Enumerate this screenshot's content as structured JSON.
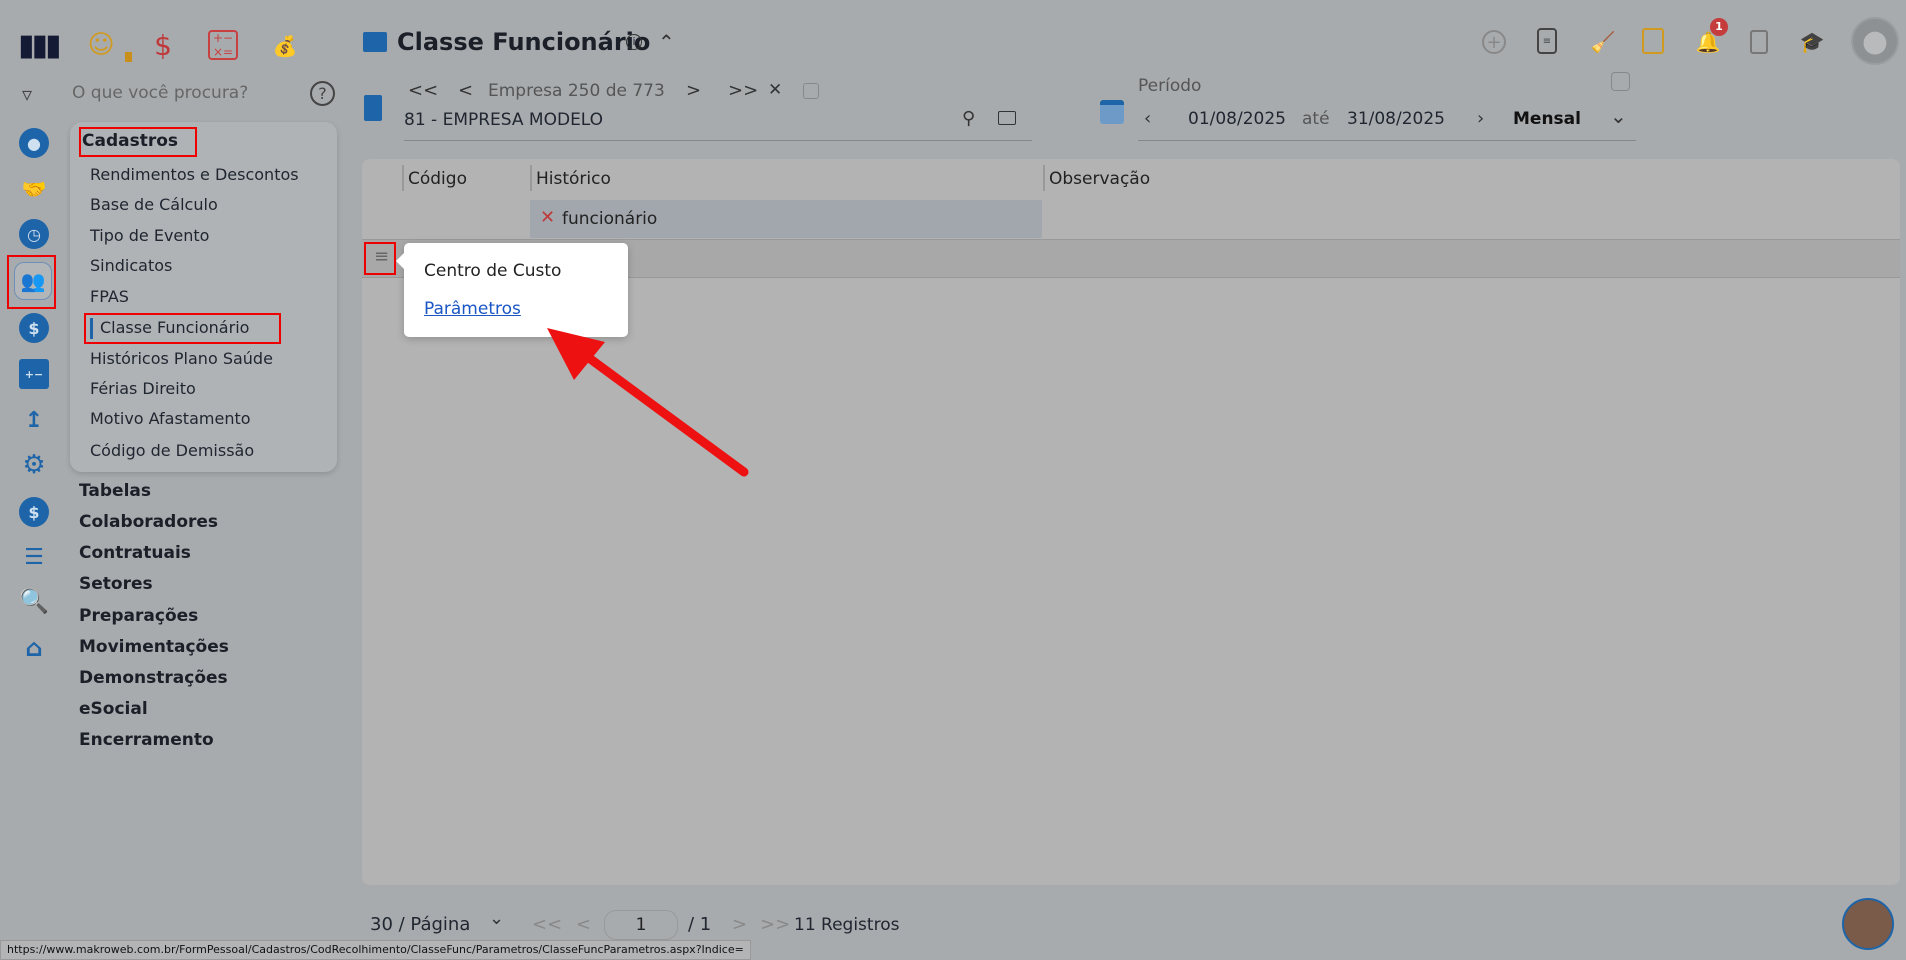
{
  "header": {
    "title": "Classe Funcionário",
    "info_icon": "info-icon",
    "collapse_icon": "chevron-up-icon"
  },
  "module_icons": [
    "people-icon",
    "dollar-icon",
    "calculator-icon",
    "money-bag-icon"
  ],
  "toolbar_icons": [
    "add-icon",
    "document-icon",
    "broom-icon",
    "note-icon",
    "bell-icon",
    "report-search-icon",
    "graduation-cap-icon",
    "user-avatar-icon"
  ],
  "notification_count": "1",
  "search": {
    "placeholder": "O que você procura?",
    "help": "?"
  },
  "empresa": {
    "nav_text": "Empresa 250 de 773",
    "first": "<<",
    "prev": "<",
    "next": ">",
    "last": ">>",
    "clear": "✕",
    "selected": "81 - EMPRESA MODELO"
  },
  "periodo": {
    "label": "Período",
    "start": "01/08/2025",
    "sep": "até",
    "end": "31/08/2025",
    "type": "Mensal"
  },
  "menu": {
    "title": "Cadastros",
    "items": [
      "Rendimentos e Descontos",
      "Base de Cálculo",
      "Tipo de Evento",
      "Sindicatos",
      "FPAS",
      "Classe Funcionário",
      "Históricos Plano Saúde",
      "Férias Direito",
      "Motivo Afastamento",
      "Código de Demissão"
    ],
    "active": "Classe Funcionário"
  },
  "sections": [
    "Tabelas",
    "Colaboradores",
    "Contratuais",
    "Setores",
    "Preparações",
    "Movimentações",
    "Demonstrações",
    "eSocial",
    "Encerramento"
  ],
  "table": {
    "columns": [
      "Código",
      "Histórico",
      "Observação"
    ],
    "filter_value": "funcionário",
    "row_partial": "o"
  },
  "context_menu": {
    "items": [
      "Centro de Custo",
      "Parâmetros"
    ]
  },
  "pagination": {
    "page_size": "30 / Página",
    "page": "1",
    "total_pages": "/ 1",
    "records": "11 Registros",
    "first": "<<",
    "prev": "<",
    "next": ">",
    "last": ">>"
  },
  "status_url": "https://www.makroweb.com.br/FormPessoal/Cadastros/CodRecolhimento/ClasseFunc/Parametros/ClasseFuncParametros.aspx?Indice=",
  "colors": {
    "accent": "#1d64a8",
    "highlight": "#e00000",
    "link": "#1a56c4"
  }
}
